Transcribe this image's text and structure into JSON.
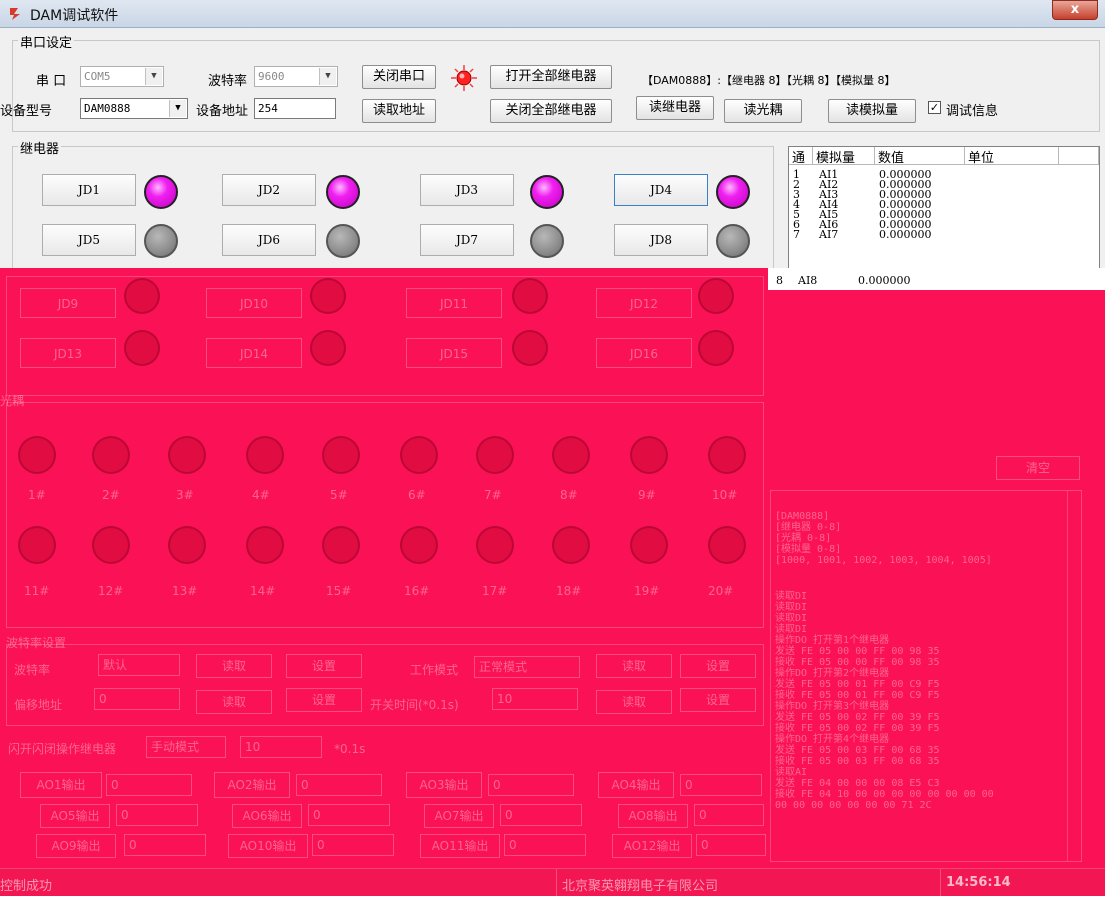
{
  "window": {
    "title": "DAM调试软件",
    "close_glyph": "x"
  },
  "serial": {
    "group_label": "串口设定",
    "port_label": "串  口",
    "port_value": "COM5",
    "baud_label": "波特率",
    "baud_value": "9600",
    "device_model_label": "设备型号",
    "device_model_value": "DAM0888",
    "device_addr_label": "设备地址",
    "device_addr_value": "254",
    "close_port_button": "关闭串口",
    "read_addr_button": "读取地址",
    "open_all_relays_button": "打开全部继电器",
    "close_all_relays_button": "关闭全部继电器",
    "read_relay_button": "读继电器",
    "read_optocoupler_button": "读光耦",
    "read_analog_button": "读模拟量",
    "debug_info_label": "调试信息",
    "debug_info_checked": true,
    "device_info": "【DAM0888】:【继电器 8】【光耦 8】【模拟量 8】"
  },
  "relays": {
    "group_label": "继电器",
    "items": [
      {
        "label": "JD1",
        "on": true
      },
      {
        "label": "JD2",
        "on": true
      },
      {
        "label": "JD3",
        "on": true
      },
      {
        "label": "JD4",
        "on": true
      },
      {
        "label": "JD5",
        "on": false
      },
      {
        "label": "JD6",
        "on": false
      },
      {
        "label": "JD7",
        "on": false
      },
      {
        "label": "JD8",
        "on": false
      }
    ],
    "hidden_items": [
      "JD9",
      "JD10",
      "JD11",
      "JD12",
      "JD13",
      "JD14",
      "JD15",
      "JD16"
    ]
  },
  "analog_table": {
    "headers": [
      "通",
      "模拟量",
      "数值",
      "单位"
    ],
    "rows": [
      {
        "ch": "1",
        "name": "AI1",
        "value": "0.000000"
      },
      {
        "ch": "2",
        "name": "AI2",
        "value": "0.000000"
      },
      {
        "ch": "3",
        "name": "AI3",
        "value": "0.000000"
      },
      {
        "ch": "4",
        "name": "AI4",
        "value": "0.000000"
      },
      {
        "ch": "5",
        "name": "AI5",
        "value": "0.000000"
      },
      {
        "ch": "6",
        "name": "AI6",
        "value": "0.000000"
      },
      {
        "ch": "7",
        "name": "AI7",
        "value": "0.000000"
      },
      {
        "ch": "8",
        "name": "AI8",
        "value": "0.000000"
      }
    ]
  },
  "optocoupler": {
    "group_label": "光耦",
    "labels": [
      "1#",
      "2#",
      "3#",
      "4#",
      "5#",
      "6#",
      "7#",
      "8#",
      "9#",
      "10#",
      "11#",
      "12#",
      "13#",
      "14#",
      "15#",
      "16#",
      "17#",
      "18#",
      "19#",
      "20#"
    ]
  },
  "log": {
    "clear_button": "清空",
    "lines": [
      "[DAM0888]",
      "  [继电器 0-8]",
      "  [光耦 0-8]",
      "  [模拟量 0-8]",
      "  [1000, 1001, 1002, 1003, 1004, 1005]",
      "读取DI",
      "读取DI",
      "读取DI",
      "读取DI",
      "操作DO  打开第1个继电器",
      "发送 FE 05 00 00 FF 00 98 35",
      "接收 FE 05 00 00 FF 00 98 35",
      "操作DO  打开第2个继电器",
      "发送 FE 05 00 01 FF 00 C9 F5",
      "接收 FE 05 00 01 FF 00 C9 F5",
      "操作DO  打开第3个继电器",
      "发送 FE 05 00 02 FF 00 39 F5",
      "接收 FE 05 00 02 FF 00 39 F5",
      "操作DO  打开第4个继电器",
      "发送 FE 05 00 03 FF 00 68 35",
      "接收 FE 05 00 03 FF 00 68 35",
      "读取AI",
      "发送 FE 04 00 00 00 08 E5 C3",
      "接收 FE 04 10 00 00 00 00 00 00 00 00",
      "00 00 00 00 00 00 00 71 2C"
    ]
  },
  "baud_settings": {
    "group_label": "波特率设置",
    "baud_label": "波特率",
    "baud_value": "默认",
    "read_button": "读取",
    "set_button": "设置",
    "work_mode_label": "工作模式",
    "work_mode_value": "正常模式",
    "offset_addr_label": "偏移地址",
    "offset_addr_value": "0",
    "switch_time_label": "开关时间(*0.1s)",
    "switch_time_value": "10"
  },
  "flash": {
    "label": "闪开闪闭操作继电器",
    "mode_value": "手动模式",
    "time_value": "10",
    "unit": "*0.1s"
  },
  "ao_outputs": {
    "labels": [
      "AO1输出",
      "AO2输出",
      "AO3输出",
      "AO4输出",
      "AO5输出",
      "AO6输出",
      "AO7输出",
      "AO8输出",
      "AO9输出",
      "AO10输出",
      "AO11输出",
      "AO12输出"
    ],
    "value": "0"
  },
  "status": {
    "message": "控制成功",
    "company": "北京聚英翱翔电子有限公司",
    "time": "14:56:14"
  },
  "colors": {
    "led_on": "#f020f0",
    "led_off": "#8c8c8c",
    "corruption": "#fb1155"
  },
  "icons": {
    "app": "app-logo-icon",
    "signal_led": "status-led-icon",
    "close": "close-icon"
  }
}
